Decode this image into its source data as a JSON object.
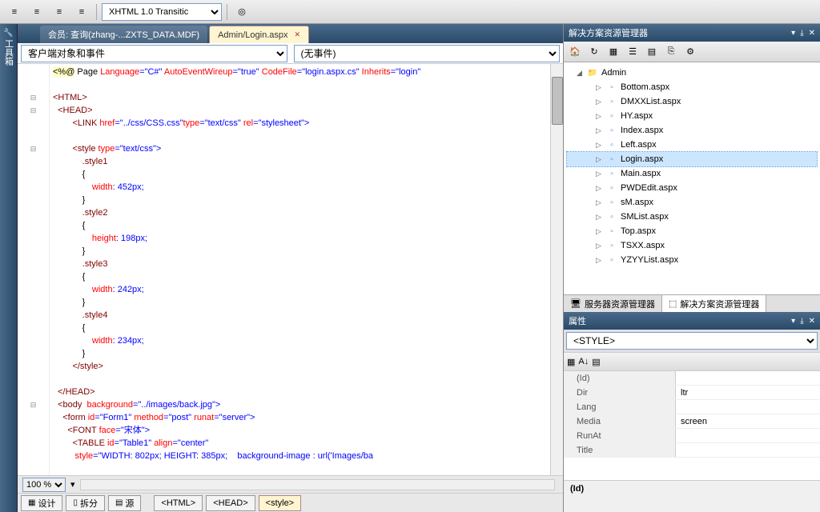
{
  "toolbar": {
    "doctype_select": "XHTML 1.0 Transitic"
  },
  "tabs": {
    "tab1": "会员: 查询(zhang-...ZXTS_DATA.MDF)",
    "tab2": "Admin/Login.aspx"
  },
  "crumb": {
    "left": "客户端对象和事件",
    "right": "(无事件)"
  },
  "code": {
    "l1a": "<%@",
    "l1b": " Page ",
    "l1c": "Language",
    "l1d": "=\"C#\" ",
    "l1e": "AutoEventWireup",
    "l1f": "=\"true\" ",
    "l1g": "CodeFile",
    "l1h": "=\"login.aspx.cs\" ",
    "l1i": "Inherits",
    "l1j": "=\"login\"",
    "l3": "<HTML>",
    "l4": "  <HEAD>",
    "l5a": "        <LINK ",
    "l5b": "href",
    "l5c": "=\"../css/CSS.css\"",
    "l5d": "type",
    "l5e": "=\"text/css\" ",
    "l5f": "rel",
    "l5g": "=\"stylesheet\">",
    "l7a": "        <style ",
    "l7b": "type",
    "l7c": "=\"text/css\">",
    "l8": "            .style1",
    "l9": "            {",
    "l10a": "                ",
    "l10b": "width",
    "l10c": ": 452px;",
    "l11": "            }",
    "l12": "            .style2",
    "l13": "            {",
    "l14a": "                ",
    "l14b": "height",
    "l14c": ": 198px;",
    "l15": "            }",
    "l16": "            .style3",
    "l17": "            {",
    "l18a": "                ",
    "l18b": "width",
    "l18c": ": 242px;",
    "l19": "            }",
    "l20": "            .style4",
    "l21": "            {",
    "l22a": "                ",
    "l22b": "width",
    "l22c": ": 234px;",
    "l23": "            }",
    "l24": "        </style>",
    "l26": "  </HEAD>",
    "l27a": "  <body  ",
    "l27b": "background",
    "l27c": "=\"../images/back.jpg\">",
    "l28a": "    <form ",
    "l28b": "id",
    "l28c": "=\"Form1\" ",
    "l28d": "method",
    "l28e": "=\"post\" ",
    "l28f": "runat",
    "l28g": "=\"server\">",
    "l29a": "      <FONT ",
    "l29b": "face",
    "l29c": "=\"宋体\">",
    "l30a": "        <TABLE ",
    "l30b": "id",
    "l30c": "=\"Table1\" ",
    "l30d": "align",
    "l30e": "=\"center\"",
    "l31a": "         ",
    "l31b": "style",
    "l31c": "=\"WIDTH: 802px; HEIGHT: 385px;    background-image : url('Images/ba"
  },
  "status": {
    "zoom": "100 %"
  },
  "bottombar": {
    "design": "设计",
    "split": "拆分",
    "source": "源",
    "p1": "<HTML>",
    "p2": "<HEAD>",
    "p3": "<style>"
  },
  "left_strip": "工具箱",
  "solution": {
    "title": "解决方案资源管理器",
    "folder": "Admin",
    "files": [
      "Bottom.aspx",
      "DMXXList.aspx",
      "HY.aspx",
      "Index.aspx",
      "Left.aspx",
      "Login.aspx",
      "Main.aspx",
      "PWDEdit.aspx",
      "sM.aspx",
      "SMList.aspx",
      "Top.aspx",
      "TSXX.aspx",
      "YZYYList.aspx"
    ],
    "tab_server": "服务器资源管理器",
    "tab_solution": "解决方案资源管理器"
  },
  "props": {
    "title": "属性",
    "combo": "<STYLE>",
    "rows": [
      {
        "n": "(Id)",
        "v": ""
      },
      {
        "n": "Dir",
        "v": "ltr"
      },
      {
        "n": "Lang",
        "v": ""
      },
      {
        "n": "Media",
        "v": "screen"
      },
      {
        "n": "RunAt",
        "v": ""
      },
      {
        "n": "Title",
        "v": ""
      }
    ],
    "desc_title": "(Id)"
  }
}
